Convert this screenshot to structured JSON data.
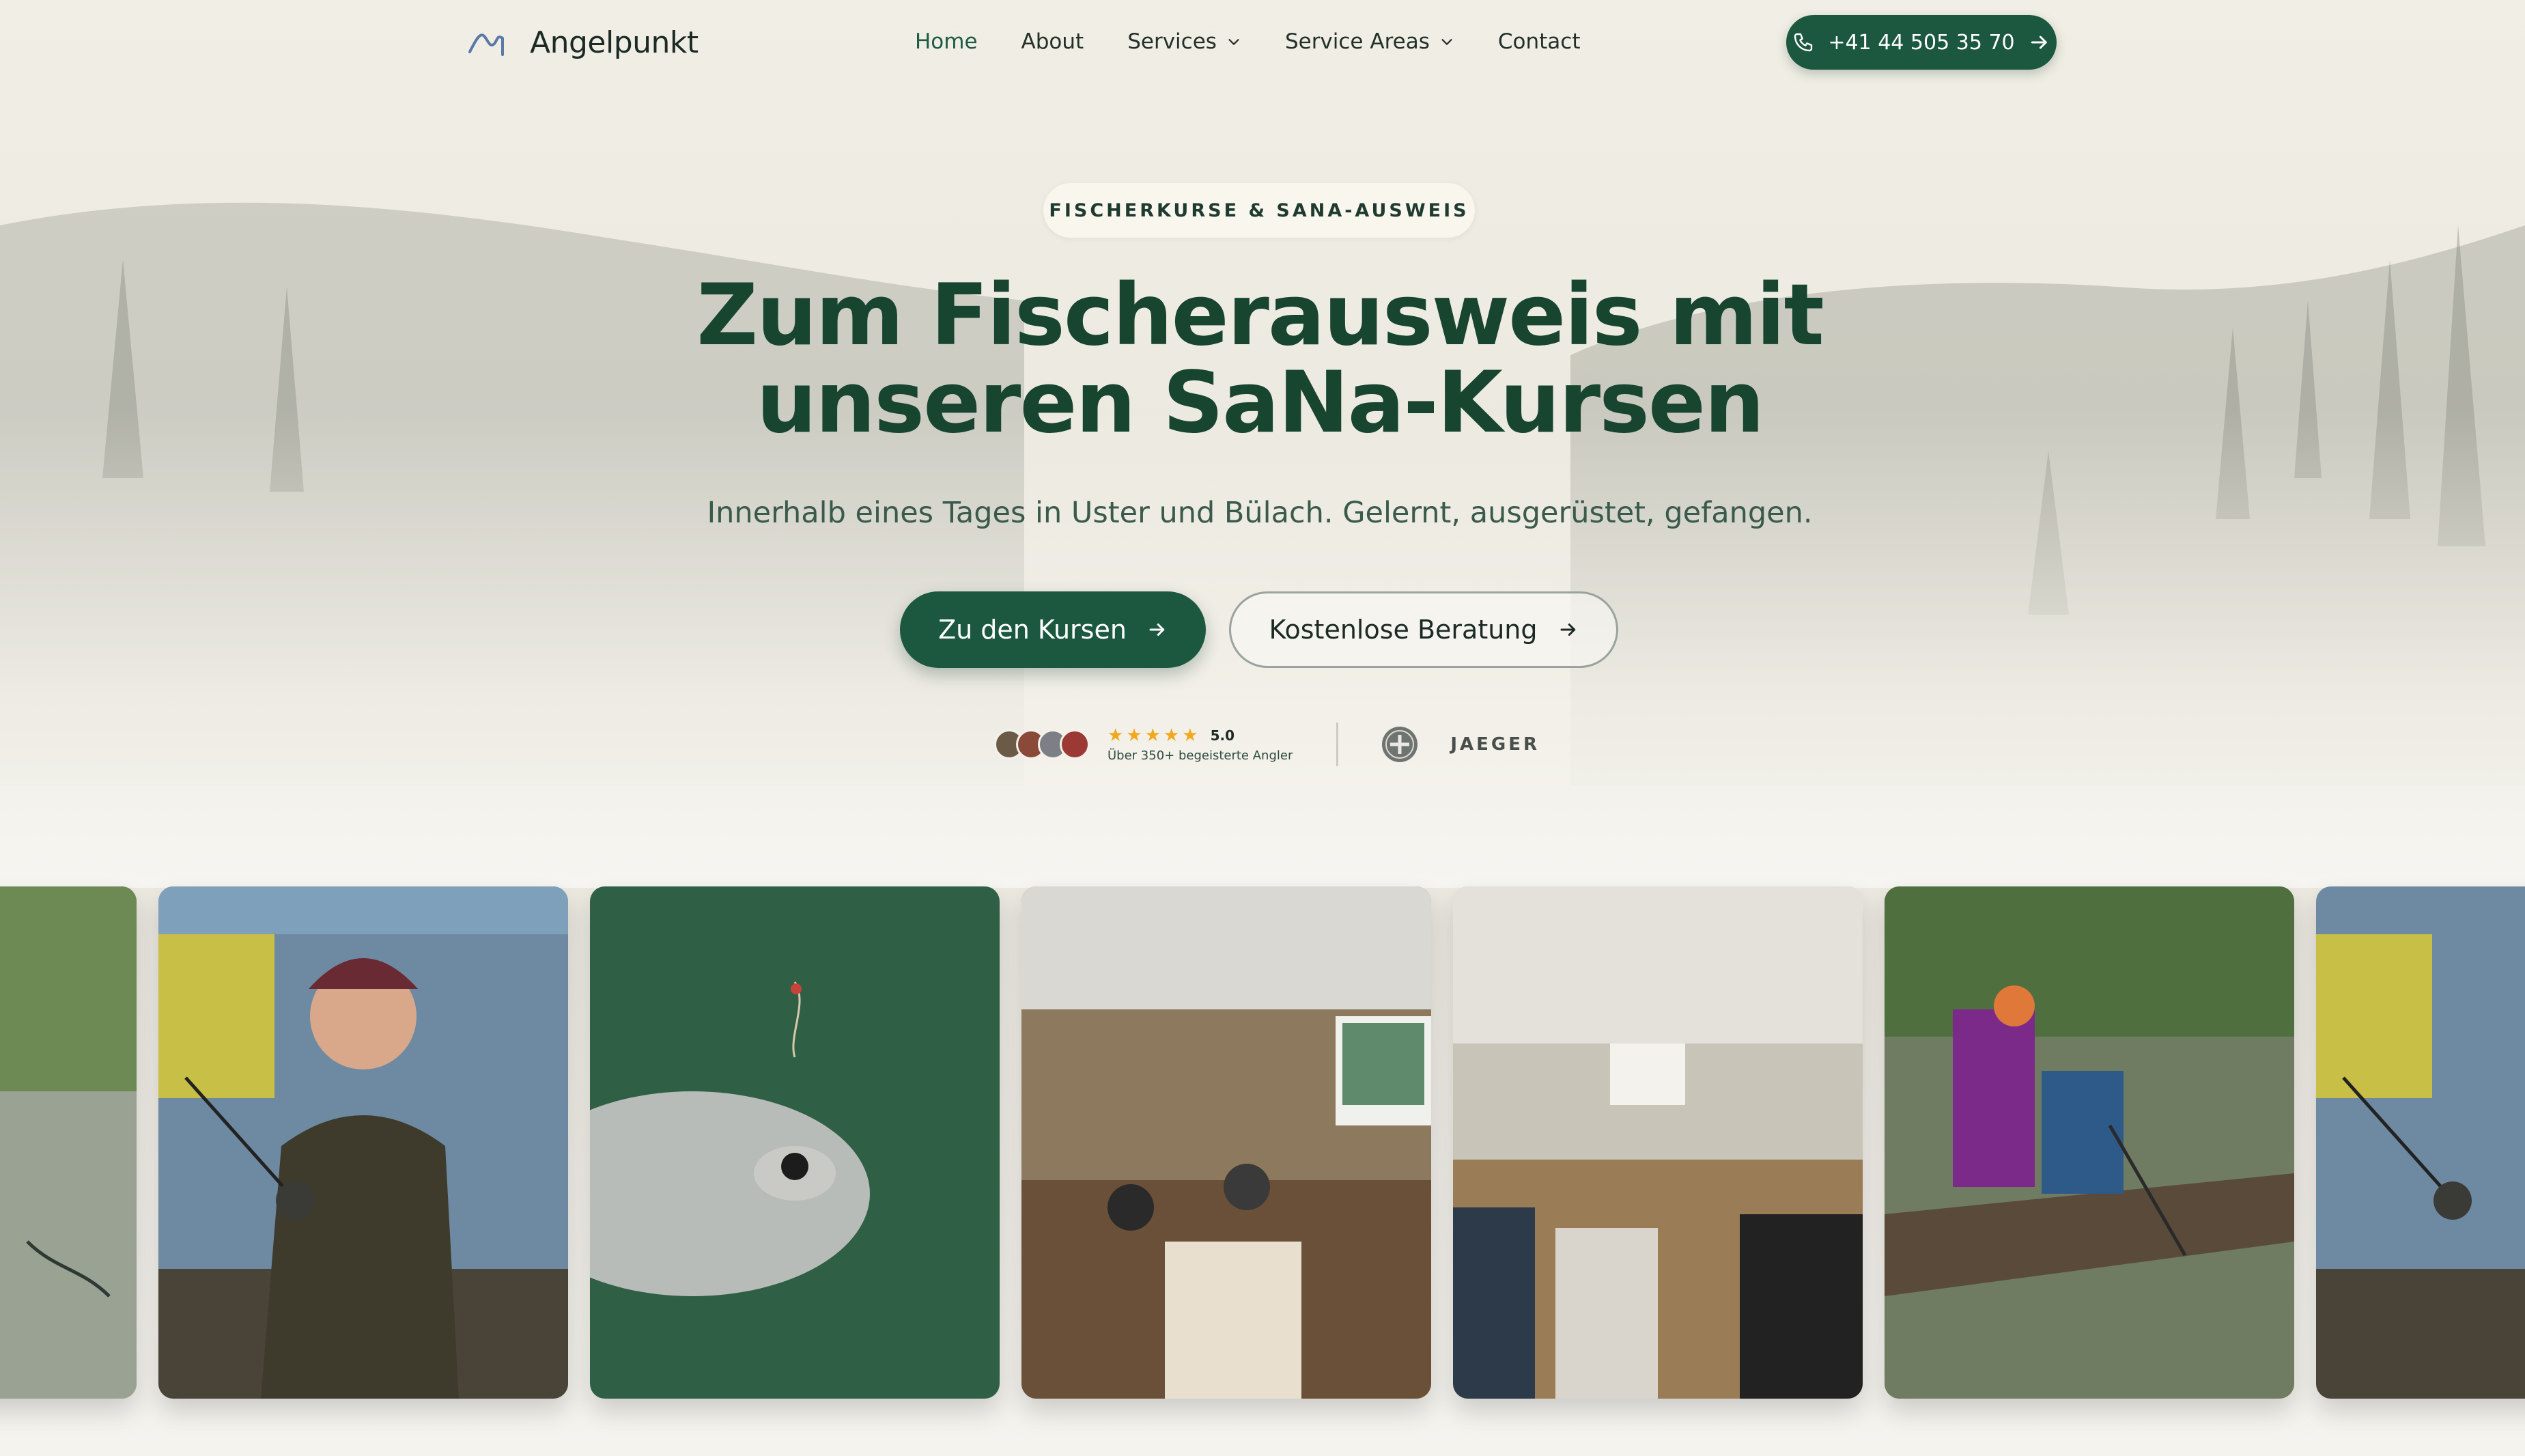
{
  "brand": {
    "name": "Angelpunkt",
    "logo_icon": "fishing-line-logo-icon"
  },
  "nav": {
    "items": [
      {
        "label": "Home",
        "active": true,
        "dropdown": false
      },
      {
        "label": "About",
        "active": false,
        "dropdown": false
      },
      {
        "label": "Services",
        "active": false,
        "dropdown": true
      },
      {
        "label": "Service Areas",
        "active": false,
        "dropdown": true
      },
      {
        "label": "Contact",
        "active": false,
        "dropdown": false
      }
    ],
    "phone": "+41 44 505 35 70"
  },
  "hero": {
    "badge": "FISCHERKURSE & SANA-AUSWEIS",
    "title_line1": "Zum Fischerausweis mit",
    "title_line2": "unseren SaNa-Kursen",
    "subtitle": "Innerhalb eines Tages in Uster und Bülach. Gelernt, ausgerüstet, gefangen.",
    "cta_primary": "Zu den Kursen",
    "cta_secondary": "Kostenlose Beratung"
  },
  "social_proof": {
    "rating": 5.0,
    "rating_text": "5.0",
    "stars": 5,
    "caption": "Über 350+ begeisterte Angler",
    "partner": "JAEGER"
  },
  "gallery": {
    "photos": [
      "angler-at-river",
      "instructor-with-fishing-rod",
      "fish-on-hook-closeup",
      "classroom-presentation",
      "course-participants-room",
      "landing-fish-from-dock",
      "instructor-with-fishing-rod-repeat"
    ]
  },
  "colors": {
    "accent": "#1c5840",
    "title": "#18452f",
    "background": "#f3f1e9",
    "star": "#f2a81c"
  }
}
